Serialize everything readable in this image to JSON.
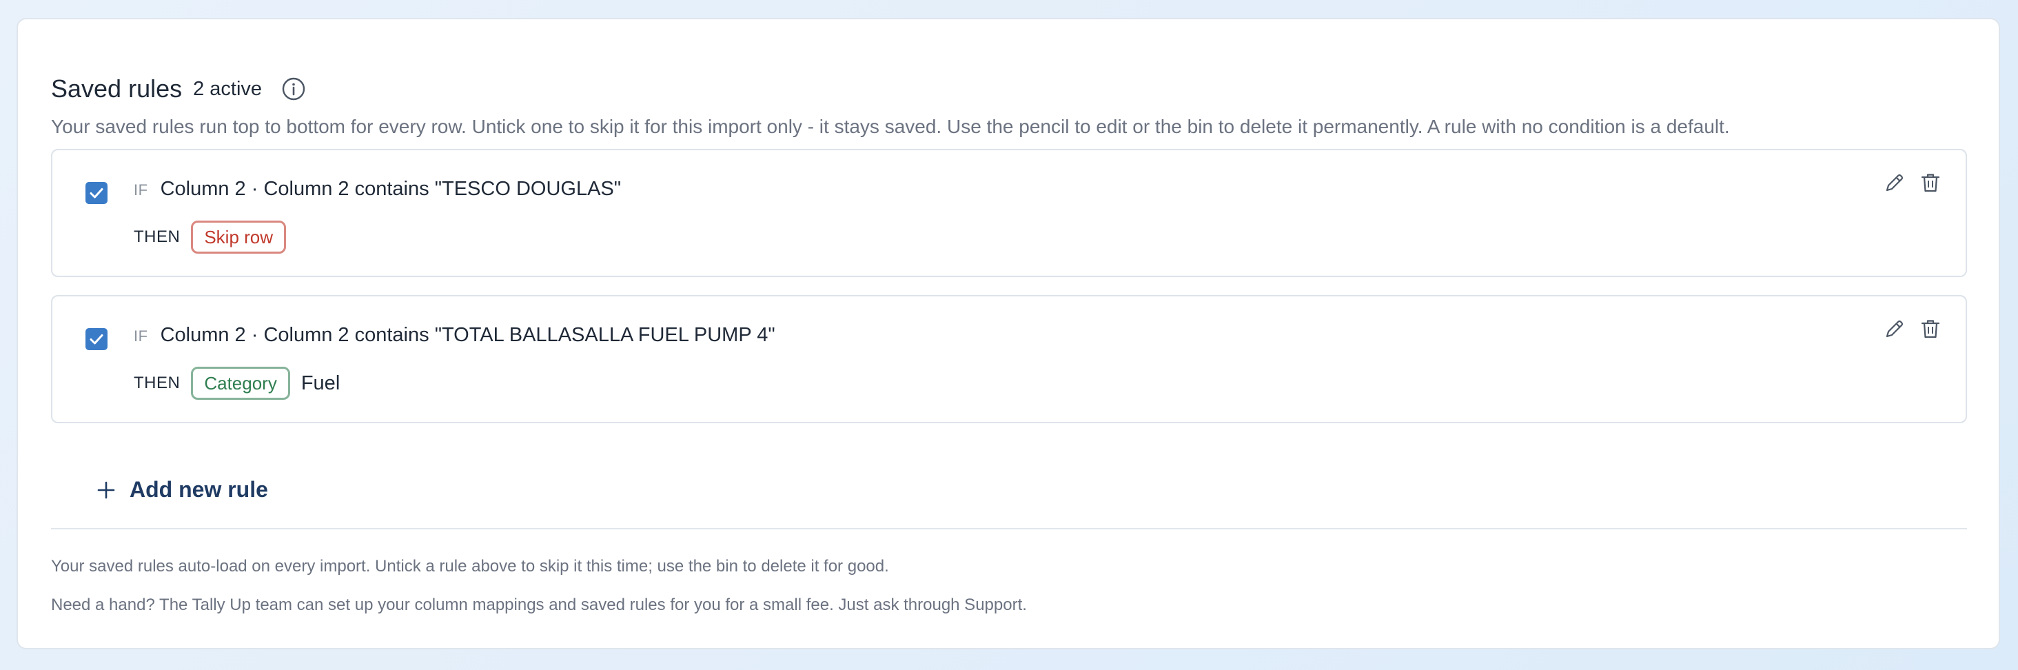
{
  "header": {
    "title": "Saved rules",
    "active_count": "2 active",
    "description": "Your saved rules run top to bottom for every row. Untick one to skip it for this import only - it stays saved. Use the pencil to edit or the bin to delete it permanently. A rule with no condition is a default."
  },
  "rules": [
    {
      "checked": true,
      "if_label": "IF",
      "condition": "Column 2 · Column 2 contains \"TESCO DOUGLAS\"",
      "then_label": "THEN",
      "action": "Skip row",
      "value": ""
    },
    {
      "checked": true,
      "if_label": "IF",
      "condition": "Column 2 · Column 2 contains \"TOTAL BALLASALLA FUEL PUMP 4\"",
      "then_label": "THEN",
      "action": "Category",
      "value": "Fuel"
    }
  ],
  "add_rule_label": "Add new rule",
  "footer": {
    "note1": "Your saved rules auto-load on every import. Untick a rule above to skip it this time; use the bin to delete it for good.",
    "note2": "Need a hand? The Tally Up team can set up your column mappings and saved rules for you for a small fee. Just ask through Support."
  },
  "icons": {
    "info": "info-icon",
    "edit": "pencil-icon",
    "delete": "trash-icon",
    "check": "check-icon",
    "add": "plus-icon"
  },
  "colors": {
    "checkbox": "#3a7bc8",
    "skip_pill": "#c0392b",
    "category_pill": "#2e7d4f",
    "add_rule_text": "#1f3b63"
  }
}
